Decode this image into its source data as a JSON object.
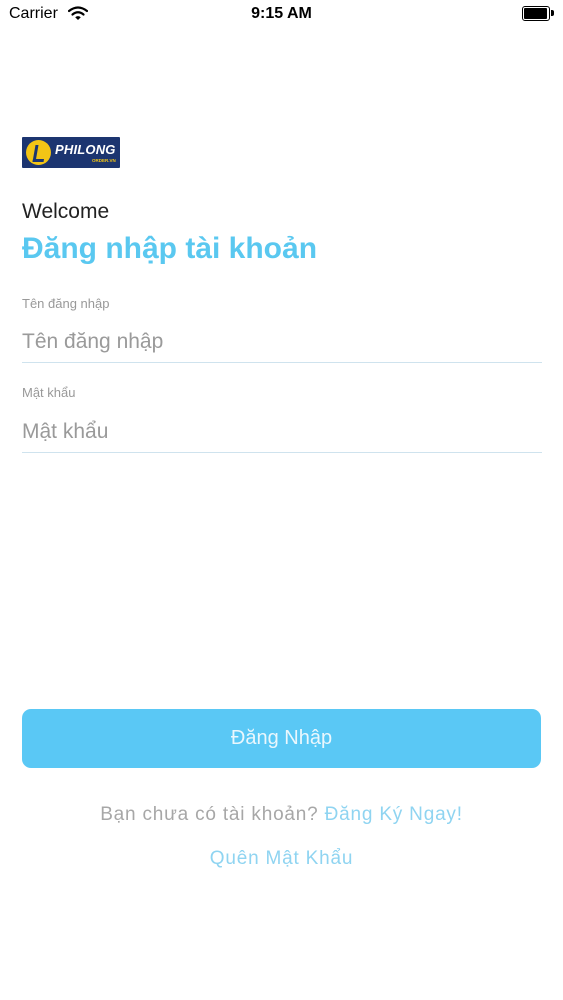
{
  "status_bar": {
    "carrier": "Carrier",
    "time": "9:15 AM",
    "wifi_icon": "wifi-icon",
    "battery_icon": "battery-full-icon",
    "battery_level": 1.0
  },
  "logo": {
    "name": "PHILONG",
    "subtitle": "ORDER.VN",
    "icon": "philong-logo-mark"
  },
  "header": {
    "welcome": "Welcome",
    "title": "Đăng nhập tài khoản"
  },
  "form": {
    "username": {
      "label": "Tên đăng nhập",
      "placeholder": "Tên đăng nhập",
      "value": ""
    },
    "password": {
      "label": "Mật khẩu",
      "placeholder": "Mật khẩu",
      "value": ""
    },
    "login_button": "Đăng Nhập"
  },
  "footer": {
    "signup_prompt": "Bạn chưa có tài khoản?",
    "signup_link": "Đăng Ký Ngay!",
    "forgot_link": "Quên Mật Khẩu"
  },
  "colors": {
    "accent": "#5ac8f0",
    "button_bg": "#5ac8f5",
    "link": "#8fd4f1",
    "logo_bg": "#1c3570",
    "logo_mark": "#f3c515"
  }
}
